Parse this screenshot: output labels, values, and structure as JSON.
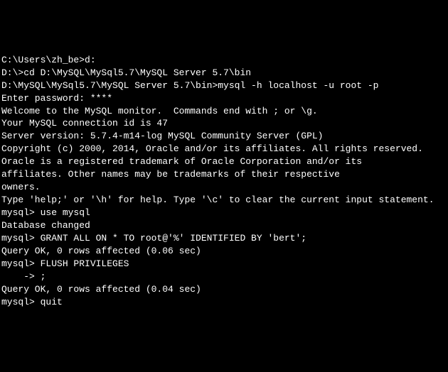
{
  "lines": [
    "C:\\Users\\zh_be>d:",
    "",
    "D:\\>cd D:\\MySQL\\MySql5.7\\MySQL Server 5.7\\bin",
    "",
    "D:\\MySQL\\MySql5.7\\MySQL Server 5.7\\bin>mysql -h localhost -u root -p",
    "Enter password: ****",
    "Welcome to the MySQL monitor.  Commands end with ; or \\g.",
    "Your MySQL connection id is 47",
    "Server version: 5.7.4-m14-log MySQL Community Server (GPL)",
    "",
    "Copyright (c) 2000, 2014, Oracle and/or its affiliates. All rights reserved.",
    "",
    "Oracle is a registered trademark of Oracle Corporation and/or its",
    "affiliates. Other names may be trademarks of their respective",
    "owners.",
    "",
    "Type 'help;' or '\\h' for help. Type '\\c' to clear the current input statement.",
    "",
    "mysql> use mysql",
    "Database changed",
    "mysql> GRANT ALL ON * TO root@'%' IDENTIFIED BY 'bert';",
    "Query OK, 0 rows affected (0.06 sec)",
    "",
    "mysql> FLUSH PRIVILEGES",
    "    -> ;",
    "Query OK, 0 rows affected (0.04 sec)",
    "",
    "mysql> quit"
  ]
}
